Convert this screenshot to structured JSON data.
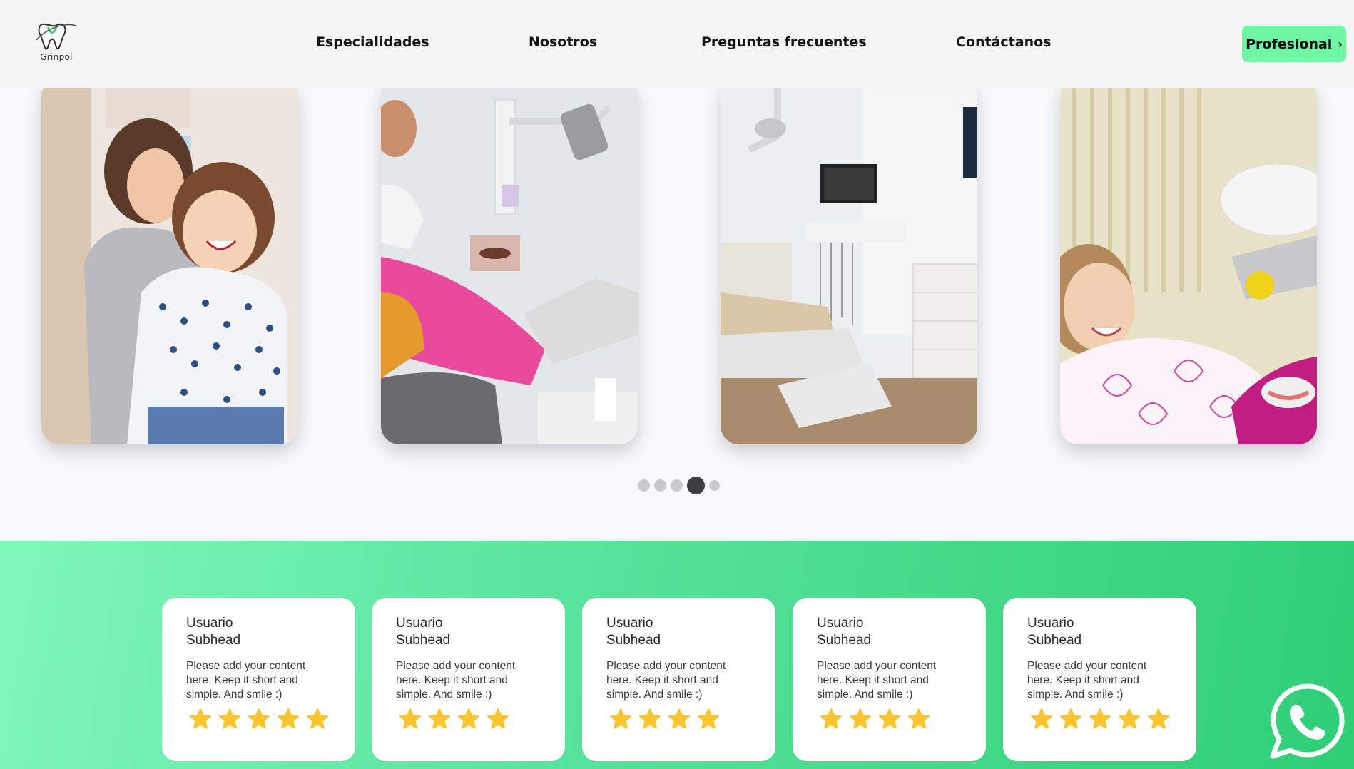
{
  "brand": {
    "name": "Grinpol",
    "accent": "#6ff7a5"
  },
  "nav": {
    "items": [
      {
        "label": "Especialidades"
      },
      {
        "label": "Nosotros"
      },
      {
        "label": "Preguntas frecuentes"
      },
      {
        "label": "Contáctanos"
      }
    ],
    "cta": {
      "label": "Profesional",
      "icon": "chevron-right-icon"
    }
  },
  "carousel": {
    "slides": [
      {
        "subject": "mother-and-child-photo"
      },
      {
        "subject": "dental-treatment-photo"
      },
      {
        "subject": "dental-clinic-room-photo"
      },
      {
        "subject": "child-patient-photo"
      }
    ],
    "dots": 5,
    "active_dot": 4
  },
  "reviews": [
    {
      "name": "Usuario",
      "subhead": "Subhead",
      "body": "Please add your content here. Keep it short and simple. And smile :)",
      "stars": 5
    },
    {
      "name": "Usuario",
      "subhead": "Subhead",
      "body": "Please add your content here. Keep it short and simple. And smile :)",
      "stars": 4
    },
    {
      "name": "Usuario",
      "subhead": "Subhead",
      "body": "Please add your content here. Keep it short and simple. And smile :)",
      "stars": 4
    },
    {
      "name": "Usuario",
      "subhead": "Subhead",
      "body": "Please add your content here. Keep it short and simple. And smile :)",
      "stars": 4
    },
    {
      "name": "Usuario",
      "subhead": "Subhead",
      "body": "Please add your content here. Keep it short and simple. And smile :)",
      "stars": 5
    }
  ],
  "colors": {
    "star": "#fbc531",
    "band_start": "#7ff7bb",
    "band_end": "#2fcf76",
    "whatsapp": "#ffffff"
  },
  "floating": {
    "icon": "whatsapp-icon"
  }
}
